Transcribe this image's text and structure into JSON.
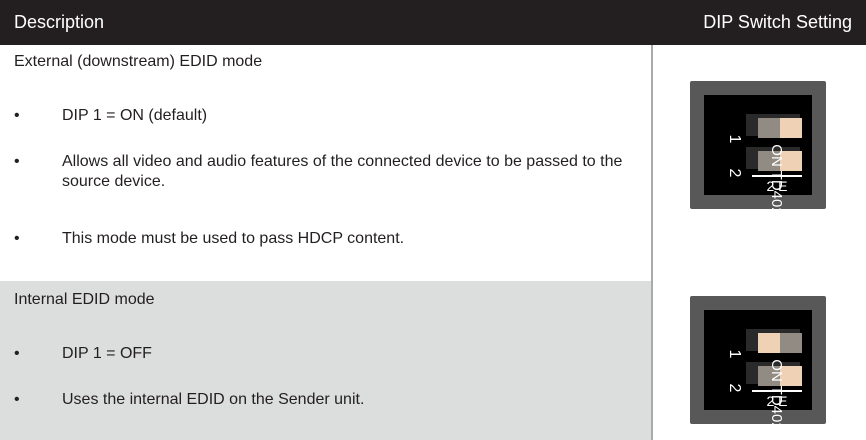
{
  "header": {
    "description": "Description",
    "dip_switch_setting": "DIP Switch Setting"
  },
  "rows": [
    {
      "title": "External (downstream) EDID mode",
      "bullets": [
        "DIP 1 = ON (default)",
        "Allows all video and audio features of the connected device to be passed to the source device.",
        "This mode must be used to pass HDCP content."
      ],
      "dip": {
        "switch1_state": "on",
        "switch2_state": "on",
        "side_label": "ON TD402",
        "bottom_label": "2 E",
        "num1": "1",
        "num2": "2"
      }
    },
    {
      "title": "Internal EDID mode",
      "bullets": [
        "DIP 1 = OFF",
        "Uses the internal EDID on the Sender unit."
      ],
      "dip": {
        "switch1_state": "off",
        "switch2_state": "on",
        "side_label": "ON TD402",
        "bottom_label": "2 E",
        "num1": "1",
        "num2": "2"
      }
    }
  ],
  "bullet_char": "•",
  "colors": {
    "header_bg": "#231f20",
    "row2_bg": "#dcdddd",
    "divider": "#a7a9ac",
    "dip_plate": "#585858",
    "knob": "#efd2b5"
  }
}
